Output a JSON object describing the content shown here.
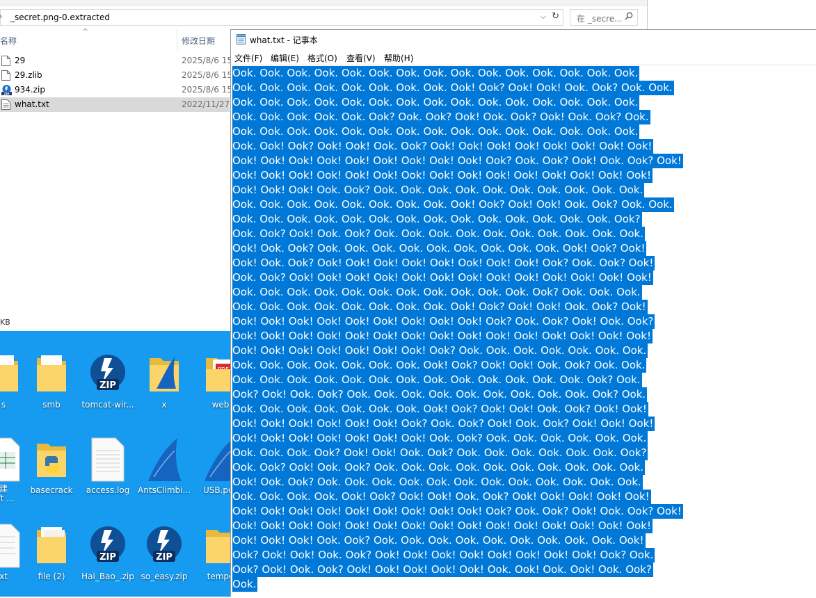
{
  "explorer": {
    "address_path": "_secret.png-0.extracted",
    "search_placeholder": "在 _secre...",
    "columns": {
      "name": "名称",
      "date": "修改日期"
    },
    "files": [
      {
        "name": "29",
        "date": "2025/8/6 15",
        "icon": "file-icon"
      },
      {
        "name": "29.zlib",
        "date": "2025/8/6 15",
        "icon": "file-icon"
      },
      {
        "name": "934.zip",
        "date": "2025/8/6 15",
        "icon": "zip-archive-icon"
      },
      {
        "name": "what.txt",
        "date": "2022/11/27",
        "icon": "text-file-icon",
        "selected": true
      }
    ],
    "status_fragment": "KB"
  },
  "desktop": {
    "background_color": "#169bf0",
    "icons": [
      {
        "label": "s",
        "icon": "folder-icon"
      },
      {
        "label": "smb",
        "icon": "folder-icon"
      },
      {
        "label": "tomcat-wir...",
        "icon": "bandizip-archive-icon"
      },
      {
        "label": "x",
        "icon": "wireshark-folder-icon"
      },
      {
        "label": "web",
        "icon": "pdf-folder-icon"
      },
      {
        "label": "建",
        "label2": "oft ...",
        "icon": "excel-file-icon"
      },
      {
        "label": "basecrack",
        "icon": "python-folder-icon"
      },
      {
        "label": "access.log",
        "icon": "text-file-icon"
      },
      {
        "label": "AntsClimbi...",
        "icon": "wireshark-shark-icon"
      },
      {
        "label": "USB.pca",
        "icon": "wireshark-shark-icon"
      },
      {
        "label": "xt",
        "icon": "text-file-icon"
      },
      {
        "label": "file (2)",
        "icon": "folder-icon"
      },
      {
        "label": "Hai_Bao_.zip",
        "icon": "bandizip-archive-icon"
      },
      {
        "label": "so_easy.zip",
        "icon": "bandizip-archive-icon"
      },
      {
        "label": "tempo",
        "icon": "folder-icon"
      }
    ]
  },
  "notepad": {
    "title": "what.txt - 记事本",
    "menu": [
      "文件(F)",
      "编辑(E)",
      "格式(O)",
      "查看(V)",
      "帮助(H)"
    ],
    "selection_color": "#0078d7",
    "lines": [
      "Ook. Ook. Ook. Ook. Ook. Ook. Ook. Ook. Ook. Ook. Ook. Ook. Ook. Ook. Ook.",
      "Ook. Ook. Ook. Ook. Ook. Ook. Ook. Ook. Ook! Ook? Ook! Ook! Ook. Ook? Ook. Ook.",
      "Ook. Ook. Ook. Ook. Ook. Ook. Ook. Ook. Ook. Ook. Ook. Ook. Ook. Ook. Ook.",
      "Ook. Ook. Ook. Ook. Ook. Ook? Ook. Ook? Ook! Ook. Ook? Ook! Ook. Ook? Ook.",
      "Ook. Ook. Ook. Ook. Ook. Ook. Ook. Ook. Ook. Ook. Ook. Ook. Ook. Ook. Ook.",
      "Ook. Ook! Ook? Ook! Ook! Ook. Ook? Ook! Ook! Ook! Ook! Ook! Ook! Ook! Ook!",
      "Ook! Ook! Ook! Ook! Ook! Ook! Ook! Ook! Ook! Ook? Ook. Ook? Ook! Ook. Ook? Ook!",
      "Ook! Ook! Ook! Ook! Ook! Ook! Ook! Ook! Ook! Ook! Ook! Ook! Ook! Ook! Ook!",
      "Ook! Ook! Ook! Ook. Ook? Ook. Ook. Ook. Ook. Ook. Ook. Ook. Ook. Ook. Ook.",
      "Ook. Ook. Ook. Ook. Ook. Ook. Ook. Ook. Ook! Ook? Ook! Ook! Ook. Ook? Ook. Ook.",
      "Ook. Ook. Ook. Ook. Ook. Ook. Ook. Ook. Ook. Ook. Ook. Ook. Ook. Ook. Ook?",
      "Ook. Ook? Ook! Ook. Ook? Ook. Ook. Ook. Ook. Ook. Ook. Ook. Ook. Ook. Ook.",
      "Ook! Ook. Ook? Ook. Ook. Ook. Ook. Ook. Ook. Ook. Ook. Ook. Ook! Ook? Ook!",
      "Ook! Ook. Ook? Ook! Ook! Ook! Ook! Ook! Ook! Ook! Ook! Ook? Ook. Ook? Ook!",
      "Ook. Ook? Ook! Ook! Ook! Ook! Ook! Ook! Ook! Ook! Ook! Ook! Ook! Ook! Ook!",
      "Ook. Ook. Ook. Ook. Ook. Ook. Ook. Ook. Ook. Ook. Ook. Ook? Ook. Ook. Ook.",
      "Ook. Ook. Ook. Ook. Ook. Ook. Ook. Ook. Ook! Ook? Ook! Ook! Ook. Ook? Ook!",
      "Ook! Ook! Ook! Ook! Ook! Ook! Ook! Ook! Ook! Ook? Ook. Ook? Ook! Ook. Ook?",
      "Ook! Ook! Ook! Ook! Ook! Ook! Ook! Ook! Ook! Ook! Ook! Ook! Ook! Ook! Ook!",
      "Ook! Ook! Ook! Ook! Ook! Ook! Ook! Ook? Ook. Ook. Ook. Ook. Ook. Ook. Ook.",
      "Ook. Ook. Ook. Ook. Ook. Ook. Ook. Ook! Ook? Ook! Ook! Ook. Ook? Ook. Ook.",
      "Ook. Ook. Ook. Ook. Ook. Ook. Ook. Ook. Ook. Ook. Ook. Ook. Ook. Ook? Ook.",
      "Ook? Ook! Ook. Ook? Ook. Ook. Ook. Ook. Ook. Ook. Ook. Ook. Ook. Ook? Ook.",
      "Ook. Ook. Ook. Ook. Ook. Ook. Ook. Ook! Ook? Ook! Ook! Ook. Ook? Ook! Ook!",
      "Ook! Ook! Ook! Ook! Ook! Ook! Ook? Ook. Ook? Ook! Ook. Ook? Ook! Ook! Ook!",
      "Ook! Ook! Ook! Ook! Ook! Ook! Ook! Ook. Ook? Ook. Ook. Ook. Ook. Ook. Ook.",
      "Ook. Ook. Ook. Ook? Ook! Ook! Ook. Ook? Ook. Ook. Ook. Ook. Ook. Ook. Ook?",
      "Ook. Ook? Ook! Ook. Ook? Ook. Ook. Ook. Ook. Ook. Ook. Ook. Ook. Ook. Ook.",
      "Ook! Ook. Ook? Ook. Ook. Ook. Ook. Ook. Ook. Ook. Ook. Ook. Ook. Ook. Ook.",
      "Ook. Ook. Ook. Ook. Ook! Ook? Ook! Ook! Ook. Ook? Ook! Ook! Ook! Ook! Ook!",
      "Ook! Ook! Ook! Ook! Ook! Ook! Ook! Ook! Ook! Ook? Ook. Ook? Ook! Ook. Ook? Ook!",
      "Ook! Ook! Ook! Ook! Ook! Ook! Ook! Ook! Ook! Ook! Ook! Ook! Ook! Ook! Ook!",
      "Ook! Ook! Ook! Ook. Ook? Ook. Ook. Ook. Ook. Ook. Ook. Ook. Ook. Ook. Ook!",
      "Ook? Ook! Ook! Ook. Ook? Ook! Ook! Ook! Ook! Ook! Ook! Ook! Ook! Ook? Ook.",
      "Ook? Ook! Ook. Ook? Ook! Ook! Ook! Ook! Ook! Ook. Ook! Ook. Ook! Ook. Ook?",
      "Ook."
    ]
  }
}
